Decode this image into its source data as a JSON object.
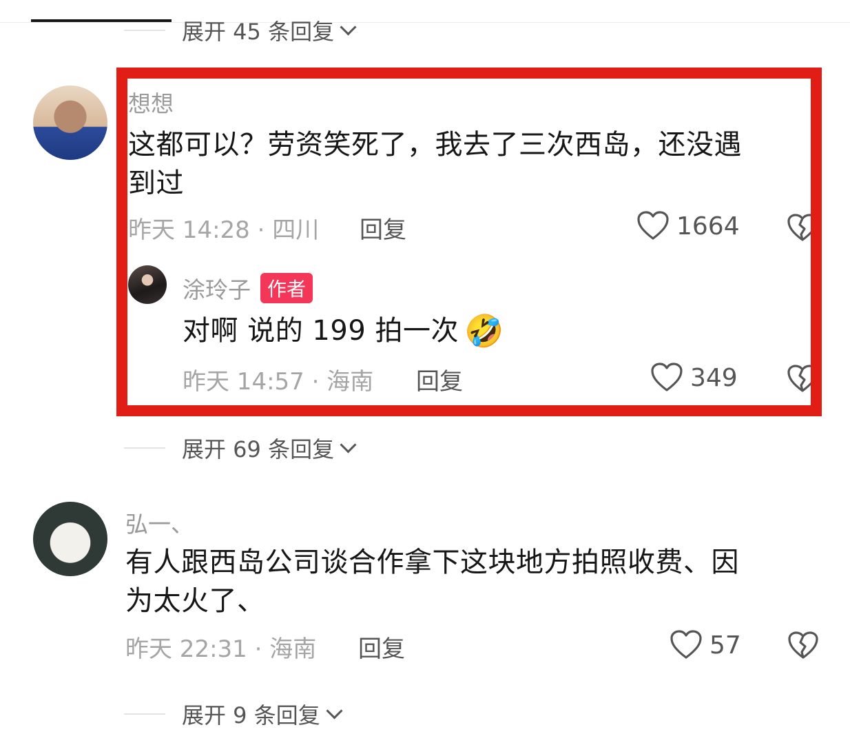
{
  "top_expand": {
    "label": "展开 45 条回复"
  },
  "comment1": {
    "author": "想想",
    "text_line1": "这都可以？劳资笑死了，我去了三次西岛，还没遇",
    "text_line2": "到过",
    "time_location": "昨天 14:28 · 四川",
    "reply_label": "回复",
    "likes": "1664",
    "reply": {
      "author": "涂玲子",
      "badge": "作者",
      "text": "对啊 说的 199 拍一次",
      "emoji": "🤣",
      "time_location": "昨天 14:57 · 海南",
      "reply_label": "回复",
      "likes": "349"
    },
    "expand_label": "展开 69 条回复"
  },
  "comment2": {
    "author": "弘一、",
    "text_line1": "有人跟西岛公司谈合作拿下这块地方拍照收费、因",
    "text_line2": "为太火了、",
    "time_location": "昨天 22:31 · 海南",
    "reply_label": "回复",
    "likes": "57",
    "expand_label": "展开 9 条回复"
  },
  "colors": {
    "highlight": "#e11e16",
    "badge": "#f43658"
  },
  "icons": [
    "heart-icon",
    "dislike-heart-icon",
    "chevron-down-icon"
  ]
}
